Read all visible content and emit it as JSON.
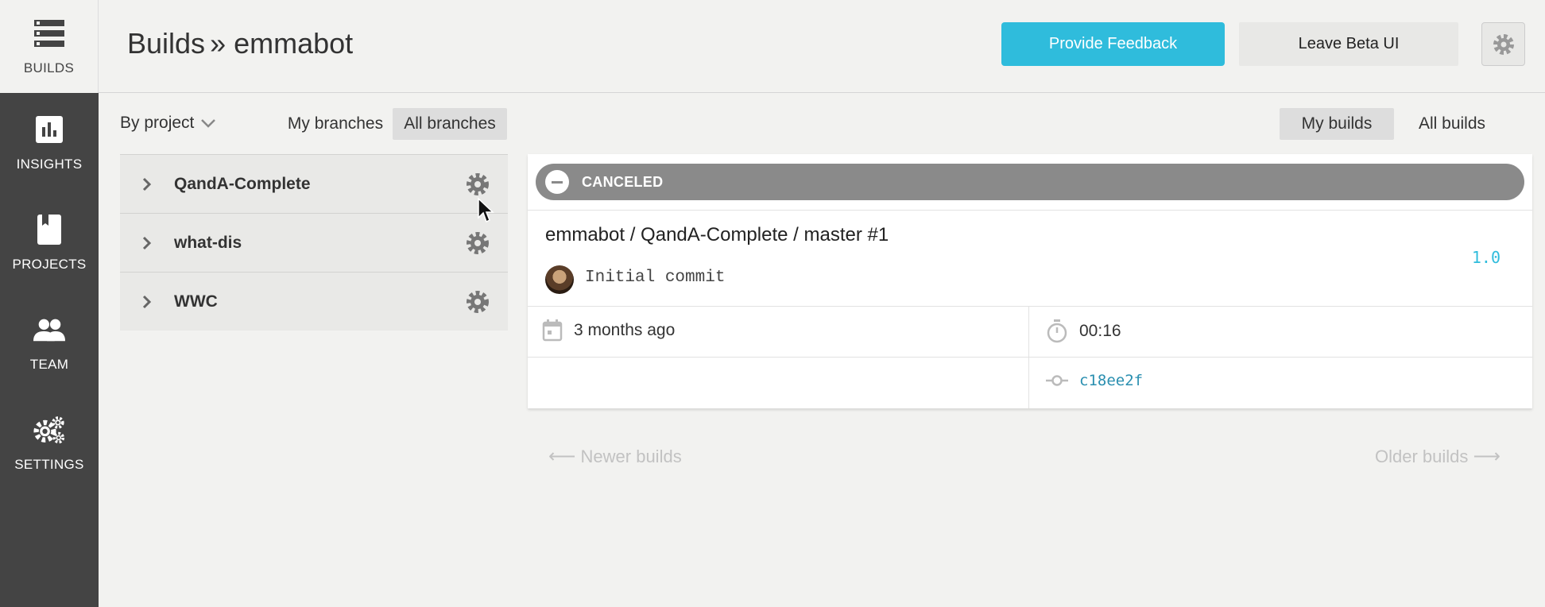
{
  "sidebar": {
    "items": [
      {
        "label": "BUILDS",
        "icon": "builds-list-icon"
      },
      {
        "label": "INSIGHTS",
        "icon": "bar-chart-icon"
      },
      {
        "label": "PROJECTS",
        "icon": "book-icon"
      },
      {
        "label": "TEAM",
        "icon": "people-icon"
      },
      {
        "label": "SETTINGS",
        "icon": "gears-icon"
      }
    ]
  },
  "header": {
    "breadcrumb_root": "Builds",
    "breadcrumb_sep": "»",
    "breadcrumb_org": "emmabot",
    "feedback_label": "Provide Feedback",
    "leave_beta_label": "Leave Beta UI"
  },
  "filters": {
    "grouping": "By project",
    "my_branches": "My branches",
    "all_branches": "All branches",
    "my_builds": "My builds",
    "all_builds": "All builds"
  },
  "projects": [
    {
      "name": "QandA-Complete"
    },
    {
      "name": "what-dis"
    },
    {
      "name": "WWC"
    }
  ],
  "build": {
    "status": "CANCELED",
    "status_color": "#8a8a8a",
    "title": "emmabot / QandA-Complete / master #1",
    "version": "1.0",
    "commit_message": "Initial commit",
    "time_ago": "3 months ago",
    "duration": "00:16",
    "commit_sha": "c18ee2f"
  },
  "pagination": {
    "newer": "Newer builds",
    "older": "Older builds"
  },
  "colors": {
    "accent": "#2fbcdc",
    "sidebar": "#444444"
  }
}
